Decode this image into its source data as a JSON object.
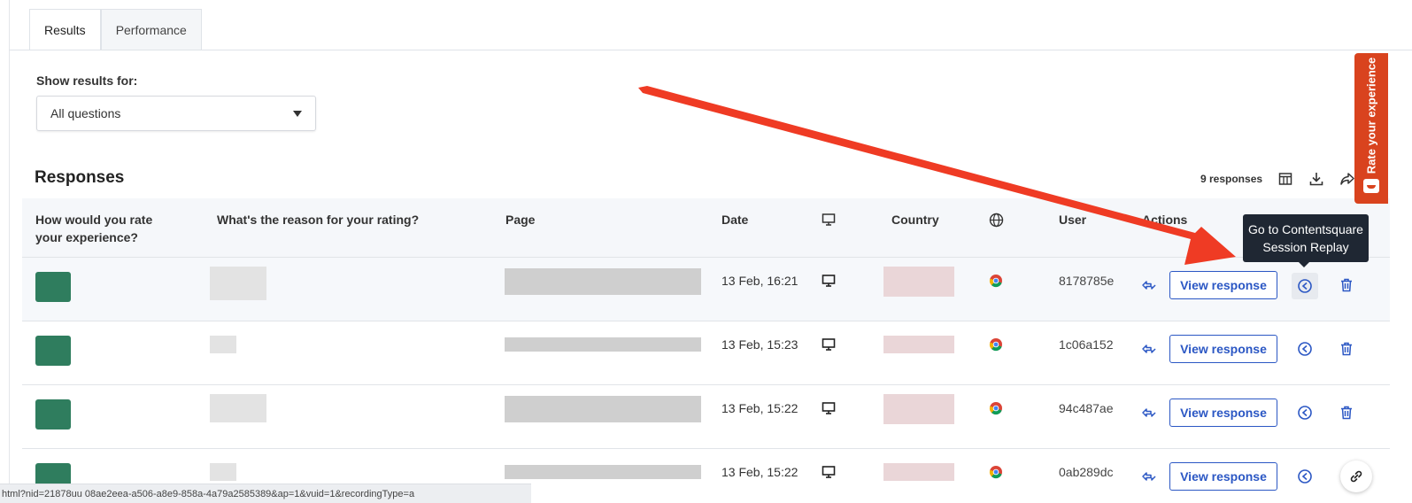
{
  "tabs": [
    {
      "label": "Results",
      "active": true
    },
    {
      "label": "Performance",
      "active": false
    }
  ],
  "filter": {
    "label": "Show results for:",
    "selected": "All questions"
  },
  "responses": {
    "title": "Responses",
    "count_label": "9 responses"
  },
  "table": {
    "headers": {
      "rating": "How would you rate your experience?",
      "reason": "What's the reason for your rating?",
      "page": "Page",
      "date": "Date",
      "country": "Country",
      "user": "User",
      "actions": "Actions"
    },
    "rows": [
      {
        "date": "13 Feb, 16:21",
        "user_id": "8178785e",
        "action_label": "View response"
      },
      {
        "date": "13 Feb, 15:23",
        "user_id": "1c06a152",
        "action_label": "View response"
      },
      {
        "date": "13 Feb, 15:22",
        "user_id": "94c487ae",
        "action_label": "View response"
      },
      {
        "date": "13 Feb, 15:22",
        "user_id": "0ab289dc",
        "action_label": "View response"
      }
    ]
  },
  "tooltip": {
    "line1": "Go to Contentsquare",
    "line2": "Session Replay"
  },
  "feedback_tab": {
    "label": "Rate your experience",
    "color": "#d9431e"
  },
  "status_url": "html?nid=21878uu 08ae2eea-a506-a8e9-858a-4a79a2585389&ap=1&vuid=1&recordingType=a",
  "colors": {
    "primary": "#2b57c4",
    "rating_icon": "#2f7d5e",
    "annotation_arrow": "#ef3b24",
    "tooltip_bg": "#1f2733"
  }
}
